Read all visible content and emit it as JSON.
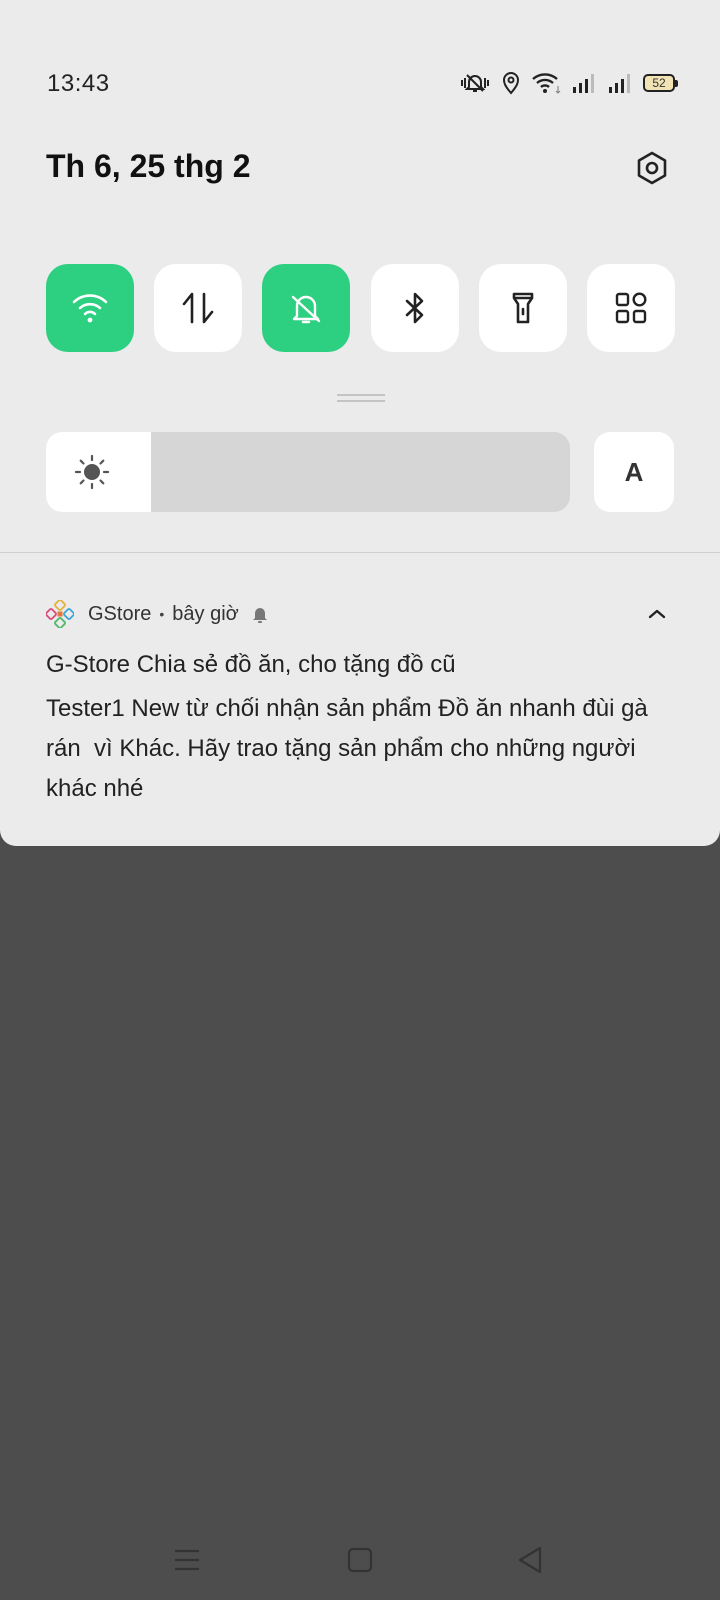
{
  "status_bar": {
    "time": "13:43",
    "icons": [
      "vibrate-off-icon",
      "location-icon",
      "wifi-icon",
      "signal-icon",
      "signal-icon"
    ],
    "battery": "52"
  },
  "header": {
    "date": "Th 6, 25 thg 2",
    "settings_icon": "settings-icon"
  },
  "quick_tiles": [
    {
      "name": "wifi",
      "icon": "wifi-icon",
      "active": true
    },
    {
      "name": "mobile-data",
      "icon": "data-arrows-icon",
      "active": false
    },
    {
      "name": "silent-mode",
      "icon": "bell-off-icon",
      "active": true
    },
    {
      "name": "bluetooth",
      "icon": "bluetooth-icon",
      "active": false
    },
    {
      "name": "flashlight",
      "icon": "flashlight-icon",
      "active": false
    },
    {
      "name": "more-tiles",
      "icon": "grid-icon",
      "active": false
    }
  ],
  "brightness": {
    "level": 0.2,
    "auto_label": "A"
  },
  "notification": {
    "app_name": "GStore",
    "time": "bây giờ",
    "title": "G-Store Chia sẻ đồ ăn, cho tặng đồ cũ",
    "body": "Tester1 New từ chối nhận sản phẩm Đồ ăn nhanh đùi gà rán  vì Khác. Hãy trao tặng sản phẩm cho những người khác nhé"
  },
  "colors": {
    "accent": "#2dcf80",
    "shade_bg": "#ebebeb",
    "backdrop": "#4d4d4d"
  }
}
